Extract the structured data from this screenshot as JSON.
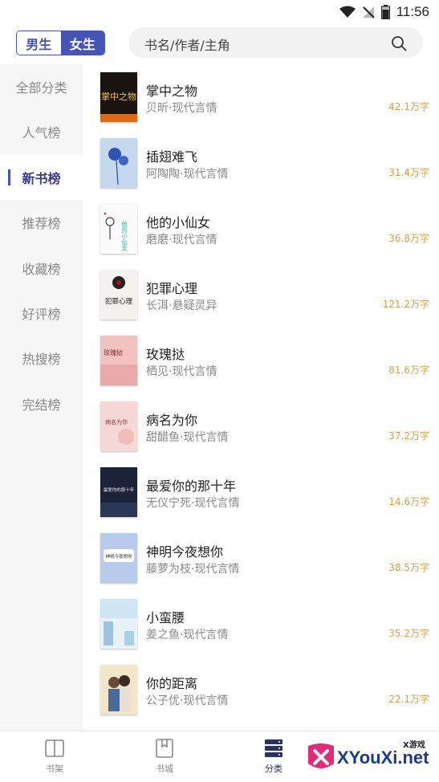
{
  "status_bar": {
    "time": "11:56"
  },
  "gender_switch": {
    "male": "男生",
    "female": "女生"
  },
  "search": {
    "placeholder": "书名/作者/主角"
  },
  "categories": [
    {
      "label": "全部分类"
    },
    {
      "label": "人气榜"
    },
    {
      "label": "新书榜"
    },
    {
      "label": "推荐榜"
    },
    {
      "label": "收藏榜"
    },
    {
      "label": "好评榜"
    },
    {
      "label": "热搜榜"
    },
    {
      "label": "完结榜"
    }
  ],
  "active_category": "新书榜",
  "books": [
    {
      "title": "掌中之物",
      "meta": "贝昕·现代言情",
      "words": "42.1万字"
    },
    {
      "title": "插翅难飞",
      "meta": "阿陶陶·现代言情",
      "words": "31.4万字"
    },
    {
      "title": "他的小仙女",
      "meta": "磨磨·现代言情",
      "words": "36.8万字"
    },
    {
      "title": "犯罪心理",
      "meta": "长洱·悬疑灵异",
      "words": "121.2万字"
    },
    {
      "title": "玫瑰挞",
      "meta": "栖见·现代言情",
      "words": "81.6万字"
    },
    {
      "title": "病名为你",
      "meta": "甜醋鱼·现代言情",
      "words": "37.2万字"
    },
    {
      "title": "最爱你的那十年",
      "meta": "无仪宁死·现代言情",
      "words": "14.6万字"
    },
    {
      "title": "神明今夜想你",
      "meta": "藤萝为枝·现代言情",
      "words": "38.5万字"
    },
    {
      "title": "小蛮腰",
      "meta": "姜之鱼·现代言情",
      "words": "35.2万字"
    },
    {
      "title": "你的距离",
      "meta": "公子优·现代言情",
      "words": "22.1万字"
    }
  ],
  "cover_text": {
    "c0": "掌中之物",
    "c2": "他的小仙女",
    "c3": "犯罪心理",
    "c4": "玫瑰挞",
    "c5": "病名为你",
    "c6": "最爱你的那十年",
    "c7": "神明今夜想你"
  },
  "tabs": [
    {
      "label": "书架",
      "icon": "book-open-icon"
    },
    {
      "label": "书城",
      "icon": "bookmark-book-icon"
    },
    {
      "label": "分类",
      "icon": "category-stack-icon"
    }
  ],
  "active_tab": "分类",
  "watermark": {
    "brand": "XYouXi.net",
    "small": "X游戏"
  },
  "colors": {
    "accent": "#4654b4",
    "word_count": "#d4a34a",
    "sidebar_bg": "#f6f6f6"
  }
}
